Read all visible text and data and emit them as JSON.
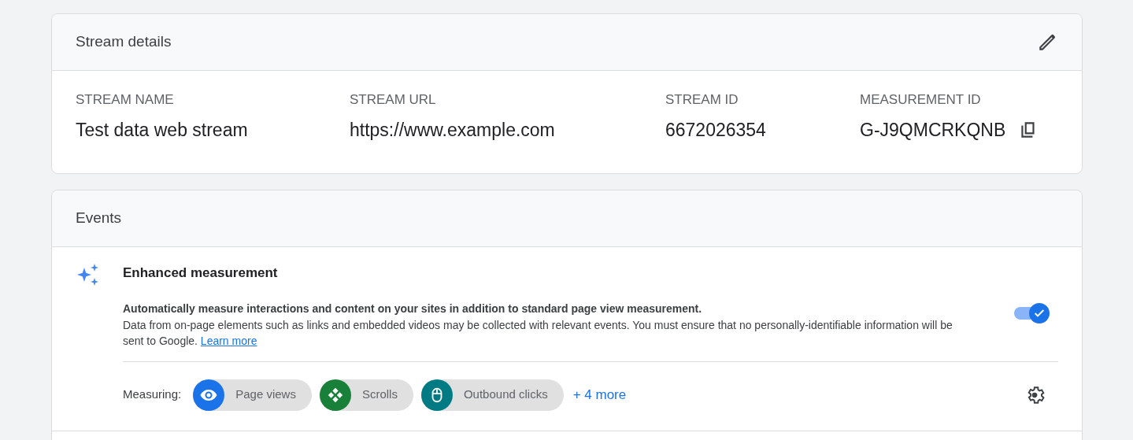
{
  "stream_details": {
    "title": "Stream details",
    "fields": [
      {
        "label": "STREAM NAME",
        "value": "Test data web stream"
      },
      {
        "label": "STREAM URL",
        "value": "https://www.example.com"
      },
      {
        "label": "STREAM ID",
        "value": "6672026354"
      },
      {
        "label": "MEASUREMENT ID",
        "value": "G-J9QMCRKQNB",
        "copyable": true
      }
    ]
  },
  "events": {
    "title": "Events",
    "enhanced": {
      "title": "Enhanced measurement",
      "lead": "Automatically measure interactions and content on your sites in addition to standard page view measurement.",
      "body": "Data from on-page elements such as links and embedded videos may be collected with relevant events. You must ensure that no personally-identifiable information will be sent to Google.",
      "link": "Learn more",
      "on": true,
      "measuring_label": "Measuring:",
      "chips": [
        {
          "kind": "eye",
          "label": "Page views",
          "color": "#1a73e8"
        },
        {
          "kind": "scroll",
          "label": "Scrolls",
          "color": "#188038"
        },
        {
          "kind": "mouse",
          "label": "Outbound clicks",
          "color": "#007b83"
        }
      ],
      "more": "+ 4 more"
    }
  }
}
